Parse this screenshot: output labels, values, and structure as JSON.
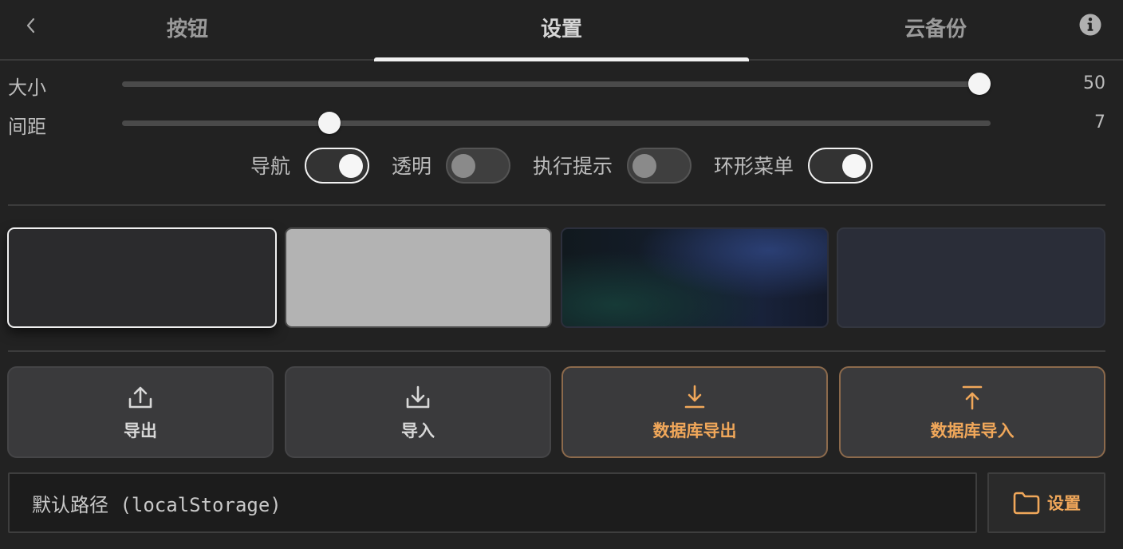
{
  "header": {
    "back_icon": "chevron-left-icon",
    "tabs": [
      {
        "label": "按钮",
        "active": false
      },
      {
        "label": "设置",
        "active": true
      },
      {
        "label": "云备份",
        "active": false
      }
    ],
    "info_icon": "info-circle-icon"
  },
  "sliders": [
    {
      "label": "大小",
      "value": "50",
      "fraction": 0.987
    },
    {
      "label": "间距",
      "value": "7",
      "fraction": 0.239
    }
  ],
  "toggles": [
    {
      "label": "导航",
      "on": true
    },
    {
      "label": "透明",
      "on": false
    },
    {
      "label": "执行提示",
      "on": false
    },
    {
      "label": "环形菜单",
      "on": true
    }
  ],
  "themes": [
    {
      "name": "dark",
      "selected": true
    },
    {
      "name": "light",
      "selected": false
    },
    {
      "name": "aurora",
      "selected": false
    },
    {
      "name": "slate",
      "selected": false
    }
  ],
  "actions": [
    {
      "label": "导出",
      "icon": "upload-icon"
    },
    {
      "label": "导入",
      "icon": "download-icon"
    },
    {
      "label": "数据库导出",
      "icon": "arrow-down-to-line-icon"
    },
    {
      "label": "数据库导入",
      "icon": "arrow-up-from-line-icon"
    }
  ],
  "path": {
    "value": "默认路径 (localStorage)",
    "button_label": "设置",
    "button_icon": "folder-icon"
  },
  "colors": {
    "background": "#222222",
    "accent": "#f0a75a",
    "accent_border": "#8c6a4c"
  }
}
